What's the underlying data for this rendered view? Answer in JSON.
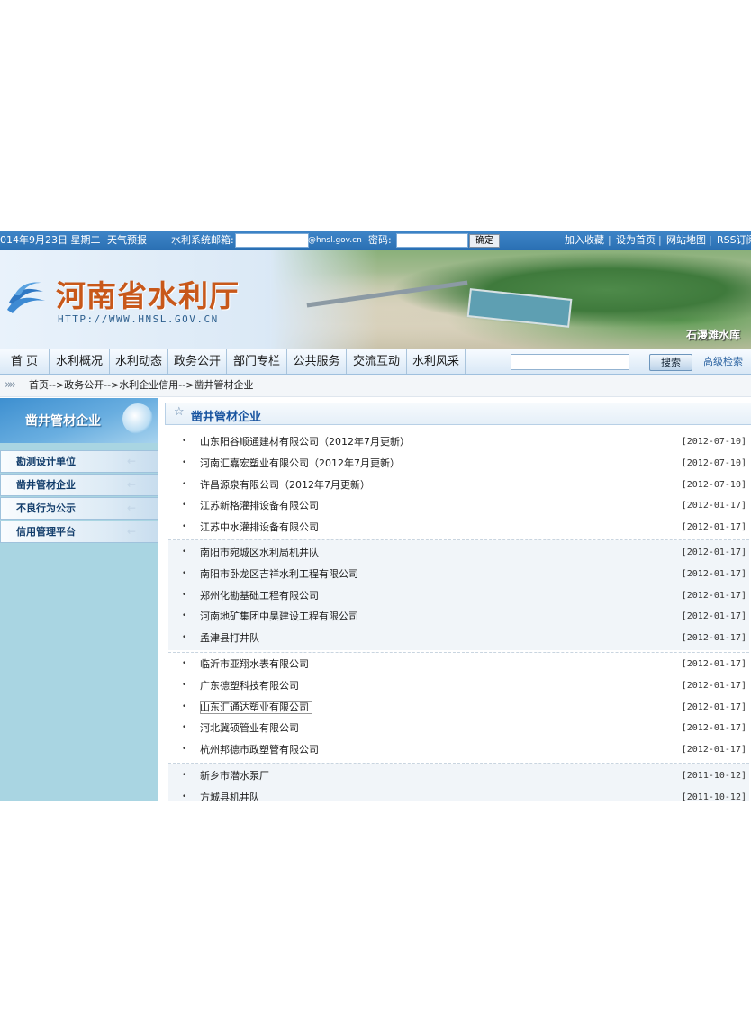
{
  "topbar": {
    "date": "014年9月23日 星期二",
    "weather": "天气预报",
    "mail_label": "水利系统邮箱:",
    "mail_domain": "@hnsl.gov.cn",
    "password_label": "密码:",
    "ok": "确定",
    "links": [
      "加入收藏",
      "设为首页",
      "网站地图",
      "RSS订阅"
    ],
    "sep": "|"
  },
  "banner": {
    "site_name": "河南省水利厅",
    "url": "HTTP://WWW.HNSL.GOV.CN",
    "caption": "石漫滩水库"
  },
  "nav": {
    "items": [
      "首 页",
      "水利概况",
      "水利动态",
      "政务公开",
      "部门专栏",
      "公共服务",
      "交流互动",
      "水利风采"
    ],
    "search_btn": "搜索",
    "advanced": "高级检索"
  },
  "breadcrumb": {
    "arrows": "»»",
    "path": "首页-->政务公开-->水利企业信用-->凿井管材企业"
  },
  "sidebar": {
    "title": "凿井管材企业",
    "menu": [
      {
        "label": "勘测设计单位",
        "arrow": "←"
      },
      {
        "label": "凿井管材企业",
        "arrow": "←"
      },
      {
        "label": "不良行为公示",
        "arrow": "←"
      },
      {
        "label": "信用管理平台",
        "arrow": "←"
      }
    ]
  },
  "main": {
    "section_title": "凿井管材企业",
    "bullet": "•",
    "groups": [
      [
        {
          "name": "山东阳谷顺通建材有限公司（2012年7月更新）",
          "date": "[2012-07-10]"
        },
        {
          "name": "河南汇嘉宏塑业有限公司（2012年7月更新）",
          "date": "[2012-07-10]"
        },
        {
          "name": "许昌源泉有限公司（2012年7月更新）",
          "date": "[2012-07-10]"
        },
        {
          "name": "江苏新格灌排设备有限公司",
          "date": "[2012-01-17]"
        },
        {
          "name": "江苏中水灌排设备有限公司",
          "date": "[2012-01-17]"
        }
      ],
      [
        {
          "name": "南阳市宛城区水利局机井队",
          "date": "[2012-01-17]"
        },
        {
          "name": "南阳市卧龙区吉祥水利工程有限公司",
          "date": "[2012-01-17]"
        },
        {
          "name": "郑州化勘基础工程有限公司",
          "date": "[2012-01-17]"
        },
        {
          "name": "河南地矿集团中昊建设工程有限公司",
          "date": "[2012-01-17]"
        },
        {
          "name": "孟津县打井队",
          "date": "[2012-01-17]"
        }
      ],
      [
        {
          "name": "临沂市亚翔水表有限公司",
          "date": "[2012-01-17]"
        },
        {
          "name": "广东德塑科技有限公司",
          "date": "[2012-01-17]"
        },
        {
          "name": "山东汇通达塑业有限公司",
          "date": "[2012-01-17]"
        },
        {
          "name": "河北冀硕管业有限公司",
          "date": "[2012-01-17]"
        },
        {
          "name": "杭州邦德市政塑管有限公司",
          "date": "[2012-01-17]"
        }
      ],
      [
        {
          "name": "新乡市潜水泵厂",
          "date": "[2011-10-12]"
        },
        {
          "name": "方城县机井队",
          "date": "[2011-10-12]"
        }
      ]
    ]
  }
}
